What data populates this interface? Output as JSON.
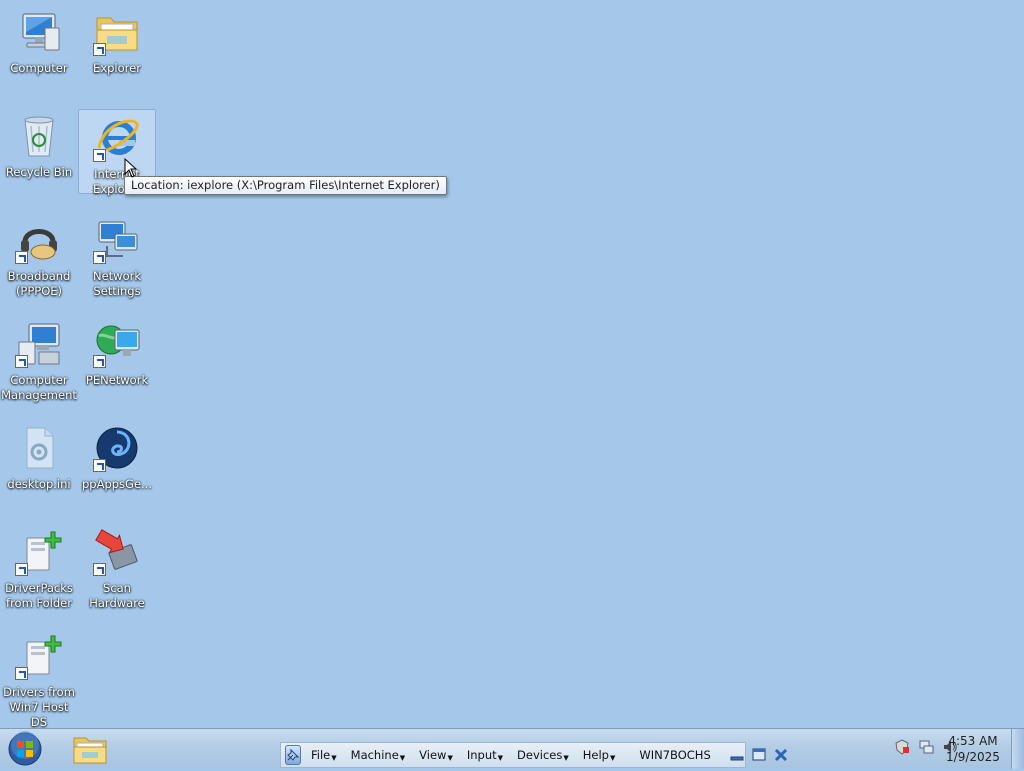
{
  "desktop": {
    "icons": [
      {
        "label": "Computer"
      },
      {
        "label": "Explorer"
      },
      {
        "label": "Recycle Bin"
      },
      {
        "label": "Internet Explorer"
      },
      {
        "label": "Broadband (PPPOE)"
      },
      {
        "label": "Network Settings"
      },
      {
        "label": "Computer Management"
      },
      {
        "label": "PENetwork"
      },
      {
        "label": "desktop.ini"
      },
      {
        "label": "ppAppsGe..."
      },
      {
        "label": "DriverPacks from Folder"
      },
      {
        "label": "Scan Hardware"
      },
      {
        "label": "Drivers from Win7 Host DS"
      }
    ],
    "tooltip": "Location: iexplore (X:\\Program Files\\Internet Explorer)"
  },
  "vm_menu": {
    "items": [
      "File",
      "Machine",
      "View",
      "Input",
      "Devices",
      "Help"
    ],
    "machine_name": "WIN7BOCHS"
  },
  "clock": {
    "time": "4:53 AM",
    "date": "1/9/2025"
  },
  "colors": {
    "desktop_bg": "#a4c7ea",
    "taskbar": "#b3cde6",
    "accent": "#1f58b3"
  }
}
